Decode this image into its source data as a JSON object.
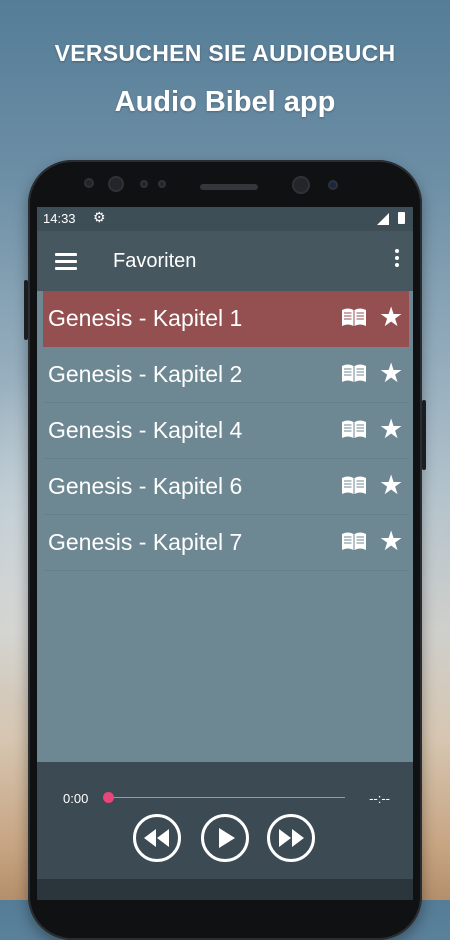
{
  "promo": {
    "line1": "VERSUCHEN SIE AUDIOBUCH",
    "line2": "Audio Bibel app"
  },
  "status_bar": {
    "time": "14:33",
    "icons": [
      "settings-gear-icon",
      "signal-icon",
      "battery-icon"
    ]
  },
  "app_bar": {
    "title": "Favoriten",
    "menu_icon": "hamburger-menu-icon",
    "overflow_icon": "more-vert-icon"
  },
  "favorites": [
    {
      "label": "Genesis - Kapitel 1",
      "selected": true
    },
    {
      "label": "Genesis - Kapitel 2",
      "selected": false
    },
    {
      "label": "Genesis - Kapitel 4",
      "selected": false
    },
    {
      "label": "Genesis - Kapitel 6",
      "selected": false
    },
    {
      "label": "Genesis - Kapitel 7",
      "selected": false
    }
  ],
  "row_icons": [
    "open-book-icon",
    "star-icon"
  ],
  "player": {
    "current_time": "0:00",
    "duration": "--:--",
    "progress": 0,
    "controls": [
      "rewind-icon",
      "play-icon",
      "fast-forward-icon"
    ]
  },
  "colors": {
    "selected_row": "#944f50",
    "list_background": "#6e8893",
    "app_bar": "#46575f",
    "player_background": "#3c4b53",
    "progress_thumb": "#e8457a"
  }
}
